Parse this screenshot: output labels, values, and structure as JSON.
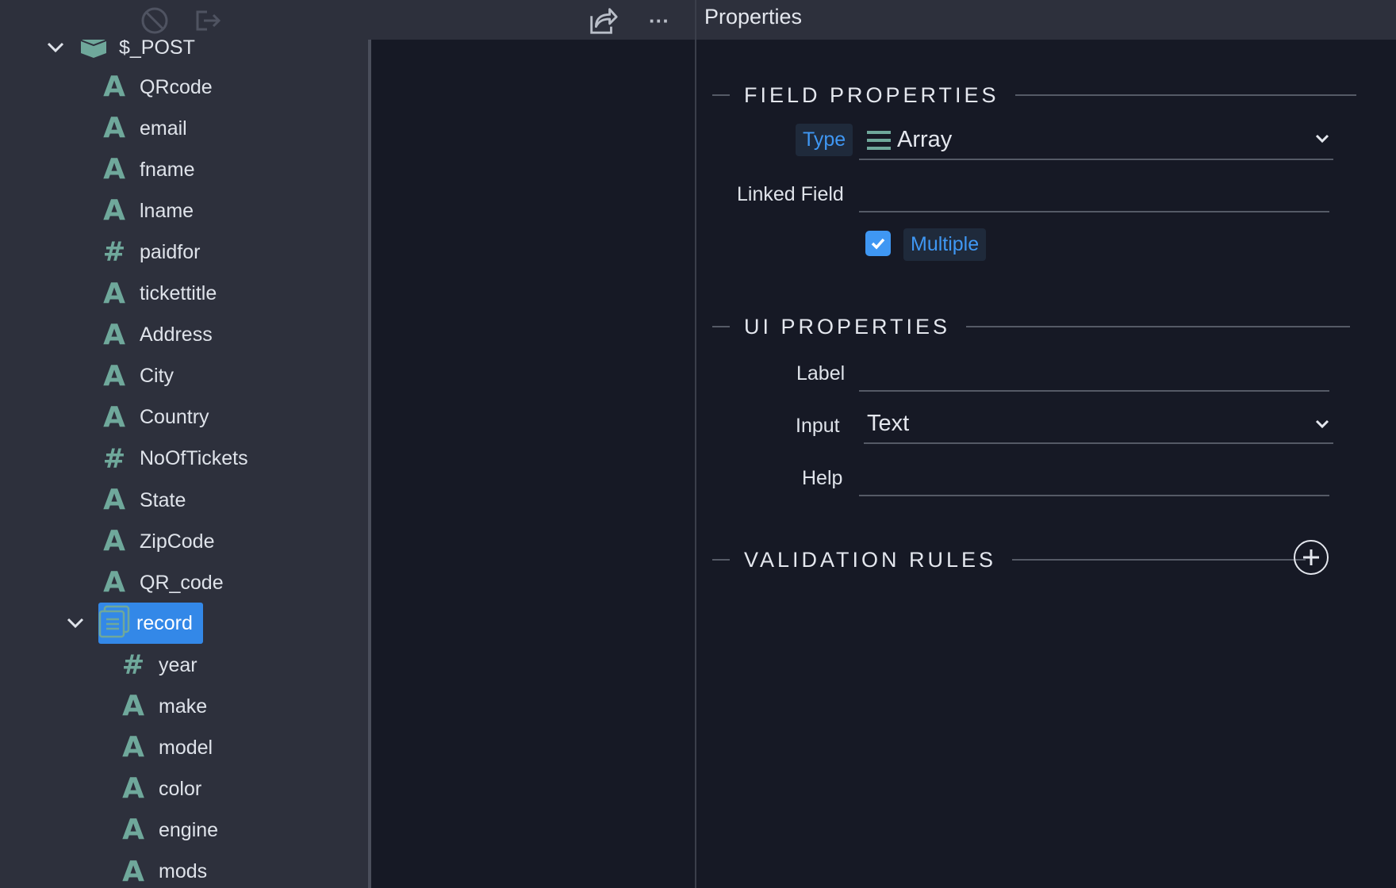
{
  "toolbar": {
    "icons": [
      "disable-icon",
      "export-icon",
      "share-icon",
      "more-icon"
    ],
    "more_label": "···"
  },
  "tree": {
    "root": {
      "label": "$_POST",
      "icon": "database-icon"
    },
    "fields": [
      {
        "label": "QRcode",
        "kind": "text"
      },
      {
        "label": "email",
        "kind": "text"
      },
      {
        "label": "fname",
        "kind": "text"
      },
      {
        "label": "lname",
        "kind": "text"
      },
      {
        "label": "paidfor",
        "kind": "number"
      },
      {
        "label": "tickettitle",
        "kind": "text"
      },
      {
        "label": "Address",
        "kind": "text"
      },
      {
        "label": "City",
        "kind": "text"
      },
      {
        "label": "Country",
        "kind": "text"
      },
      {
        "label": "NoOfTickets",
        "kind": "number"
      },
      {
        "label": "State",
        "kind": "text"
      },
      {
        "label": "ZipCode",
        "kind": "text"
      },
      {
        "label": "QR_code",
        "kind": "text"
      }
    ],
    "record": {
      "label": "record",
      "children": [
        {
          "label": "year",
          "kind": "number"
        },
        {
          "label": "make",
          "kind": "text"
        },
        {
          "label": "model",
          "kind": "text"
        },
        {
          "label": "color",
          "kind": "text"
        },
        {
          "label": "engine",
          "kind": "text"
        },
        {
          "label": "mods",
          "kind": "text"
        }
      ]
    },
    "glyphs": {
      "text": "A",
      "number": "#"
    }
  },
  "properties": {
    "title": "Properties",
    "field_section": {
      "title": "FIELD PROPERTIES",
      "type_label": "Type",
      "type_value": "Array",
      "linked_field_label": "Linked Field",
      "linked_field_value": "",
      "multiple_label": "Multiple",
      "multiple_checked": true
    },
    "ui_section": {
      "title": "UI PROPERTIES",
      "label_label": "Label",
      "label_value": "",
      "input_label": "Input",
      "input_value": "Text",
      "help_label": "Help",
      "help_value": ""
    },
    "validation_section": {
      "title": "VALIDATION RULES"
    }
  },
  "colors": {
    "accent": "#3388e8",
    "link": "#3f97f3",
    "icon_teal": "#6fa89b",
    "panel": "#2d303c",
    "background": "#161925"
  }
}
